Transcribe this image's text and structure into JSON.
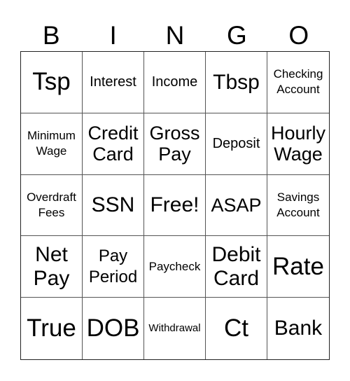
{
  "header": {
    "letters": [
      "B",
      "I",
      "N",
      "G",
      "O"
    ]
  },
  "board": {
    "rows": [
      [
        "Tsp",
        "Interest",
        "Income",
        "Tbsp",
        "Checking Account"
      ],
      [
        "Minimum Wage",
        "Credit Card",
        "Gross Pay",
        "Deposit",
        "Hourly Wage"
      ],
      [
        "Overdraft Fees",
        "SSN",
        "Free!",
        "ASAP",
        "Savings Account"
      ],
      [
        "Net Pay",
        "Pay Period",
        "Paycheck",
        "Debit Card",
        "Rate"
      ],
      [
        "True",
        "DOB",
        "Withdrawal",
        "Ct",
        "Bank"
      ]
    ],
    "free_space": "Free!"
  }
}
